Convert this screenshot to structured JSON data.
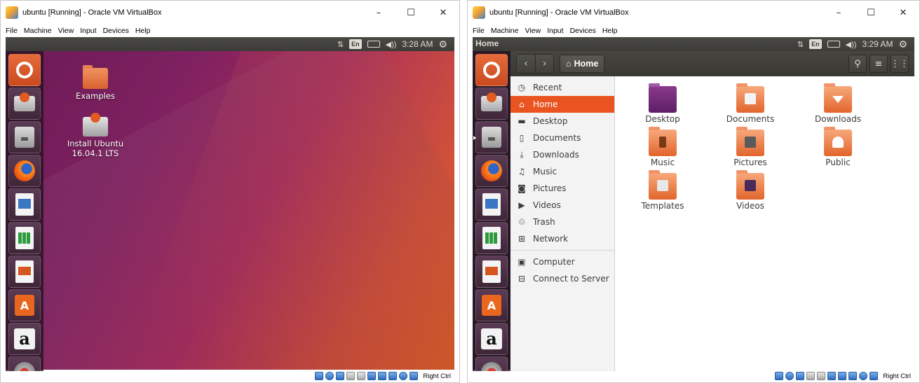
{
  "windows": [
    {
      "id": "left",
      "title": "ubuntu [Running] - Oracle VM VirtualBox",
      "controls": {
        "minimize": "–",
        "maximize": "☐",
        "close": "✕"
      },
      "menu": [
        "File",
        "Machine",
        "View",
        "Input",
        "Devices",
        "Help"
      ],
      "topbar": {
        "app_title": "",
        "keyboard": "En",
        "volume": "◀))",
        "clock": "3:28 AM",
        "network": "⇅",
        "battery": "▭",
        "system": "⚙"
      },
      "desktop_icons": [
        {
          "label": "Examples",
          "icon": "folder-icon"
        },
        {
          "label_line1": "Install Ubuntu",
          "label_line2": "16.04.1 LTS",
          "icon": "drive-icon"
        }
      ],
      "statusbar": {
        "host_key": "Right Ctrl"
      }
    },
    {
      "id": "right",
      "title": "ubuntu [Running] - Oracle VM VirtualBox",
      "controls": {
        "minimize": "–",
        "maximize": "☐",
        "close": "✕"
      },
      "menu": [
        "File",
        "Machine",
        "View",
        "Input",
        "Devices",
        "Help"
      ],
      "topbar": {
        "app_title": "Home",
        "keyboard": "En",
        "volume": "◀))",
        "clock": "3:29 AM",
        "network": "⇅",
        "battery": "▭",
        "system": "⚙"
      },
      "nautilus": {
        "path_button": "Home",
        "back": "‹",
        "forward": "›",
        "search_glyph": "⚲",
        "list_glyph": "≡",
        "grid_glyph": "⋮⋮",
        "sidebar": [
          {
            "label": "Recent",
            "icon": "◷",
            "selected": false
          },
          {
            "label": "Home",
            "icon": "⌂",
            "selected": true
          },
          {
            "label": "Desktop",
            "icon": "▬",
            "selected": false
          },
          {
            "label": "Documents",
            "icon": "▯",
            "selected": false
          },
          {
            "label": "Downloads",
            "icon": "⤓",
            "selected": false
          },
          {
            "label": "Music",
            "icon": "♫",
            "selected": false
          },
          {
            "label": "Pictures",
            "icon": "◙",
            "selected": false
          },
          {
            "label": "Videos",
            "icon": "▶",
            "selected": false
          },
          {
            "label": "Trash",
            "icon": "♲",
            "selected": false
          },
          {
            "label": "Network",
            "icon": "⊞",
            "selected": false
          },
          {
            "label": "Computer",
            "icon": "▣",
            "selected": false
          },
          {
            "label": "Connect to Server",
            "icon": "⊟",
            "selected": false
          }
        ],
        "files": [
          {
            "label": "Desktop",
            "kind": "desktop"
          },
          {
            "label": "Documents",
            "kind": "doc"
          },
          {
            "label": "Downloads",
            "kind": "down"
          },
          {
            "label": "Music",
            "kind": "music"
          },
          {
            "label": "Pictures",
            "kind": "pic"
          },
          {
            "label": "Public",
            "kind": "pub"
          },
          {
            "label": "Templates",
            "kind": "tpl"
          },
          {
            "label": "Videos",
            "kind": "vid"
          }
        ]
      },
      "statusbar": {
        "host_key": "Right Ctrl"
      }
    }
  ],
  "launcher_items": [
    "search-dash",
    "install-ubuntu",
    "files",
    "firefox",
    "libreoffice-writer",
    "libreoffice-calc",
    "libreoffice-impress",
    "ubuntu-software",
    "amazon",
    "system-settings"
  ],
  "launcher_letters": {
    "store": "A",
    "amazon": "a"
  },
  "colors": {
    "ubuntu_orange": "#e95420",
    "panel": "#3c3b37",
    "launcher": "#2c1b28"
  }
}
